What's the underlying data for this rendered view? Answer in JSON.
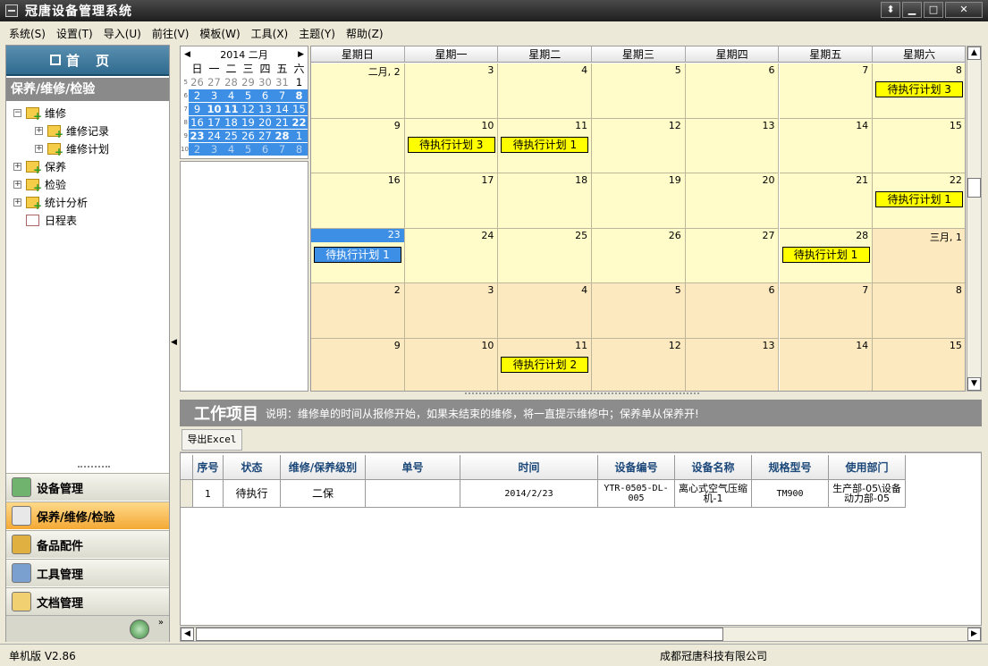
{
  "window": {
    "title": "冠唐设备管理系统",
    "min": "▁",
    "max": "□",
    "restore": "⬍",
    "close": "✕"
  },
  "menu": [
    "系统(S)",
    "设置(T)",
    "导入(U)",
    "前往(V)",
    "模板(W)",
    "工具(X)",
    "主题(Y)",
    "帮助(Z)"
  ],
  "sidebar": {
    "home": "首页",
    "section": "保养/维修/检验",
    "tree": [
      {
        "label": "维修",
        "expander": "−"
      },
      {
        "label": "维修记录",
        "expander": "+"
      },
      {
        "label": "维修计划",
        "expander": "+"
      },
      {
        "label": "保养",
        "expander": "+"
      },
      {
        "label": "检验",
        "expander": "+"
      },
      {
        "label": "统计分析",
        "expander": "+"
      },
      {
        "label": "日程表",
        "expander": ""
      }
    ],
    "nav": [
      "设备管理",
      "保养/维修/检验",
      "备品配件",
      "工具管理",
      "文档管理"
    ],
    "footer_chevron": "»"
  },
  "minical": {
    "title": "2014 二月",
    "dows": [
      "日",
      "一",
      "二",
      "三",
      "四",
      "五",
      "六"
    ],
    "weeks": [
      {
        "wk": "5",
        "days": [
          "26",
          "27",
          "28",
          "29",
          "30",
          "31",
          "1"
        ]
      },
      {
        "wk": "6",
        "days": [
          "2",
          "3",
          "4",
          "5",
          "6",
          "7",
          "8"
        ]
      },
      {
        "wk": "7",
        "days": [
          "9",
          "10",
          "11",
          "12",
          "13",
          "14",
          "15"
        ]
      },
      {
        "wk": "8",
        "days": [
          "16",
          "17",
          "18",
          "19",
          "20",
          "21",
          "22"
        ]
      },
      {
        "wk": "9",
        "days": [
          "23",
          "24",
          "25",
          "26",
          "27",
          "28",
          "1"
        ]
      },
      {
        "wk": "10",
        "days": [
          "2",
          "3",
          "4",
          "5",
          "6",
          "7",
          "8"
        ]
      }
    ]
  },
  "calendar": {
    "dows": [
      "星期日",
      "星期一",
      "星期二",
      "星期三",
      "星期四",
      "星期五",
      "星期六"
    ],
    "weeks": [
      [
        "二月, 2",
        "3",
        "4",
        "5",
        "6",
        "7",
        "8"
      ],
      [
        "9",
        "10",
        "11",
        "12",
        "13",
        "14",
        "15"
      ],
      [
        "16",
        "17",
        "18",
        "19",
        "20",
        "21",
        "22"
      ],
      [
        "23",
        "24",
        "25",
        "26",
        "27",
        "28",
        "三月, 1"
      ],
      [
        "2",
        "3",
        "4",
        "5",
        "6",
        "7",
        "8"
      ],
      [
        "9",
        "10",
        "11",
        "12",
        "13",
        "14",
        "15"
      ]
    ],
    "events": [
      {
        "week": 0,
        "day": 6,
        "label": "待执行计划 3"
      },
      {
        "week": 1,
        "day": 1,
        "label": "待执行计划 3"
      },
      {
        "week": 1,
        "day": 2,
        "label": "待执行计划 1"
      },
      {
        "week": 2,
        "day": 6,
        "label": "待执行计划 1"
      },
      {
        "week": 3,
        "day": 0,
        "label": "待执行计划 1"
      },
      {
        "week": 3,
        "day": 5,
        "label": "待执行计划 1"
      },
      {
        "week": 5,
        "day": 2,
        "label": "待执行计划 2"
      }
    ]
  },
  "work": {
    "title": "工作项目",
    "desc": "说明：维修单的时间从报修开始，如果未结束的维修，将一直提示维修中；保养单从保养开!",
    "export": "导出Excel",
    "columns": [
      "序号",
      "状态",
      "维修/保养级别",
      "单号",
      "时间",
      "设备编号",
      "设备名称",
      "规格型号",
      "使用部门"
    ],
    "rows": [
      [
        "1",
        "待执行",
        "二保",
        "",
        "2014/2/23",
        "YTR-0505-DL-005",
        "离心式空气压缩机-1",
        "TM900",
        "生产部-05\\设备动力部-05"
      ]
    ]
  },
  "status": {
    "version": "单机版  V2.86",
    "company": "成都冠唐科技有限公司"
  }
}
